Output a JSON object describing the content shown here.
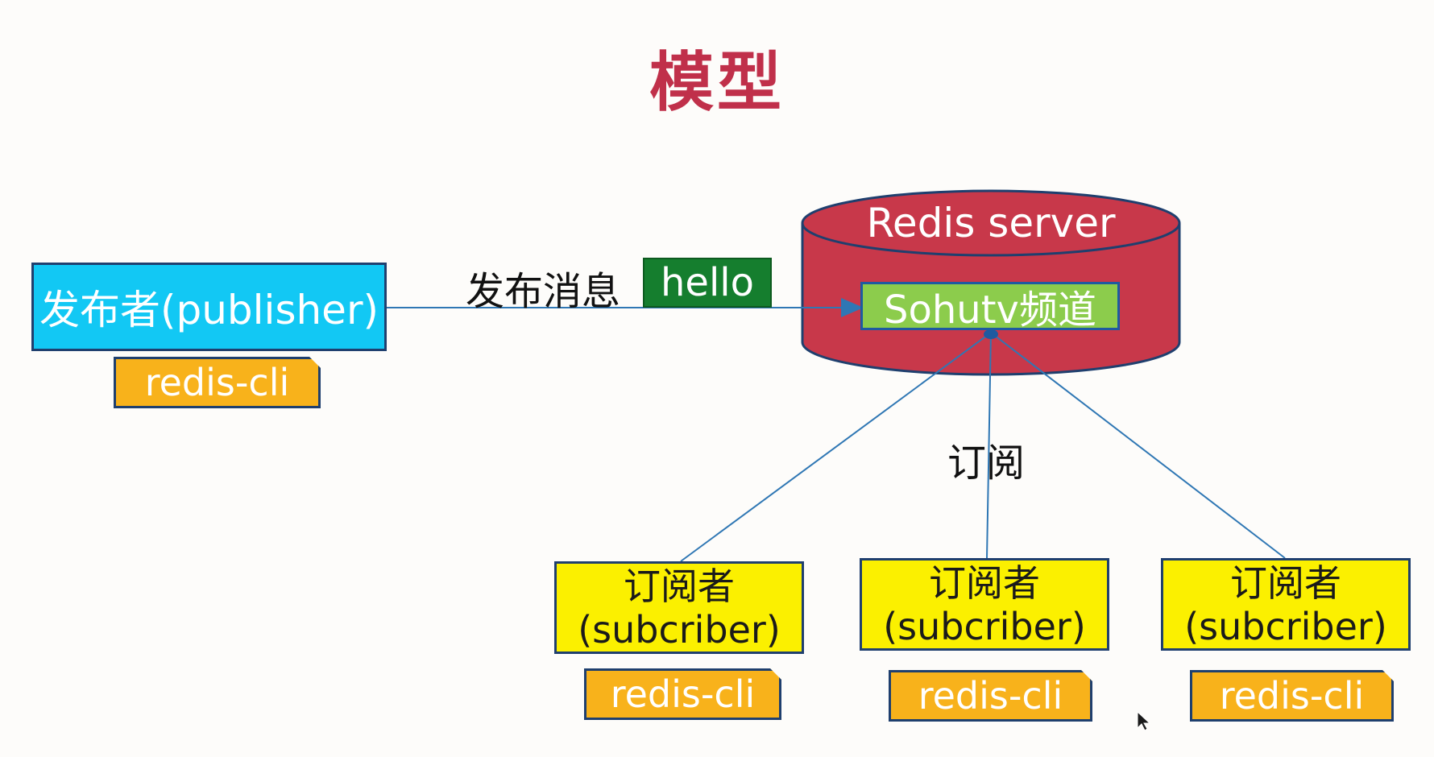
{
  "title": "模型",
  "publisher": {
    "label": "发布者(publisher)",
    "client": "redis-cli"
  },
  "publish_action": {
    "label": "发布消息",
    "message": "hello"
  },
  "server": {
    "label": "Redis server",
    "channel": "Sohutv频道"
  },
  "subscribe_action": {
    "label": "订阅"
  },
  "subscribers": [
    {
      "name": "订阅者",
      "role": "(subcriber)",
      "client": "redis-cli"
    },
    {
      "name": "订阅者",
      "role": "(subcriber)",
      "client": "redis-cli"
    },
    {
      "name": "订阅者",
      "role": "(subcriber)",
      "client": "redis-cli"
    }
  ],
  "colors": {
    "title": "#c0304a",
    "publisher_fill": "#12c8f4",
    "server_fill": "#c8384a",
    "channel_fill": "#8ccc4c",
    "message_fill": "#157e2e",
    "subscriber_fill": "#fbf000",
    "client_fill": "#f8b21b",
    "border": "#1f3f6e",
    "connector": "#2f77b4"
  }
}
